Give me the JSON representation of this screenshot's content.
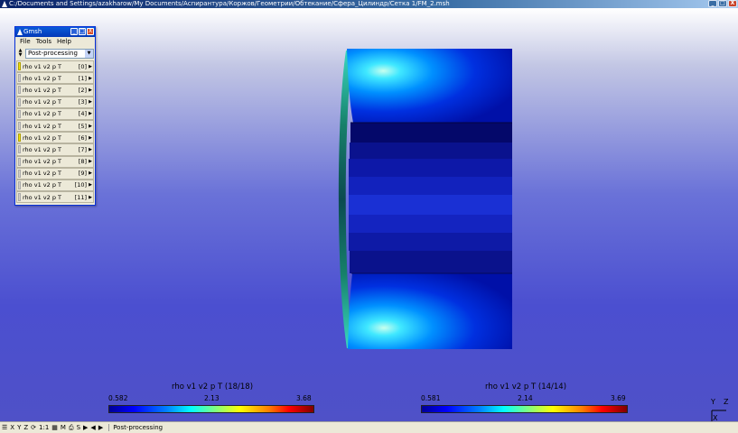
{
  "window": {
    "title": "C:/Documents and Settings/azakharow/My Documents/Аспирантура/Коржов/Геометрии/Обтекание/Сфера_Цилиндр/Сетка 1/FM_2.msh",
    "buttons": {
      "minimize": "_",
      "maximize": "□",
      "close": "X"
    }
  },
  "gmsh_window": {
    "title": "Gmsh",
    "buttons": {
      "minimize": "_",
      "maximize": "□",
      "close": "X"
    },
    "menu": {
      "file": "File",
      "tools": "Tools",
      "help": "Help"
    },
    "context": "Post-processing",
    "views": [
      {
        "name": "rho v1 v2 p T",
        "index": "[0]",
        "enabled": true
      },
      {
        "name": "rho v1 v2 p T",
        "index": "[1]",
        "enabled": false
      },
      {
        "name": "rho v1 v2 p T",
        "index": "[2]",
        "enabled": false
      },
      {
        "name": "rho v1 v2 p T",
        "index": "[3]",
        "enabled": false
      },
      {
        "name": "rho v1 v2 p T",
        "index": "[4]",
        "enabled": false
      },
      {
        "name": "rho v1 v2 p T",
        "index": "[5]",
        "enabled": false
      },
      {
        "name": "rho v1 v2 p T",
        "index": "[6]",
        "enabled": true
      },
      {
        "name": "rho v1 v2 p T",
        "index": "[7]",
        "enabled": false
      },
      {
        "name": "rho v1 v2 p T",
        "index": "[8]",
        "enabled": false
      },
      {
        "name": "rho v1 v2 p T",
        "index": "[9]",
        "enabled": false
      },
      {
        "name": "rho v1 v2 p T",
        "index": "[10]",
        "enabled": false
      },
      {
        "name": "rho v1 v2 p T",
        "index": "[11]",
        "enabled": false
      }
    ]
  },
  "scales": [
    {
      "title": "rho v1 v2 p T (18/18)",
      "min": "0.582",
      "mid": "2.13",
      "max": "3.68"
    },
    {
      "title": "rho v1 v2 p T (14/14)",
      "min": "0.581",
      "mid": "2.14",
      "max": "3.69"
    }
  ],
  "axes": {
    "y": "Y",
    "z": "Z",
    "x": "X"
  },
  "statusbar": {
    "x": "X",
    "y": "Y",
    "z": "Z",
    "one_to_one": "1:1",
    "m": "M",
    "s": "S",
    "context": "Post-processing"
  },
  "colors": {
    "title_bar": "#0a246a",
    "gmsh_title": "#0a5bd8",
    "panel_bg": "#ece9d8",
    "enabled_lamp": "#f5e400",
    "viewport_bottom": "#4f51c7"
  }
}
